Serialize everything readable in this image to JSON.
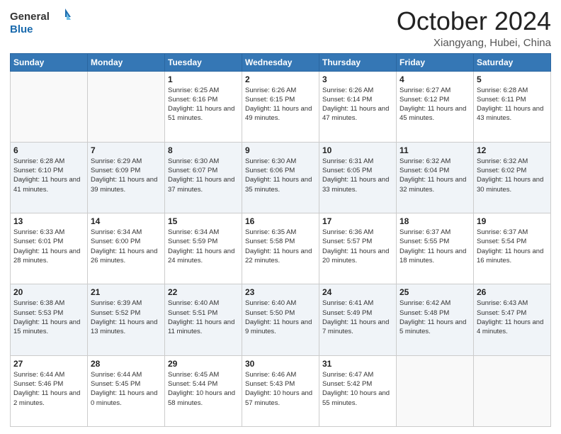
{
  "header": {
    "logo_line1": "General",
    "logo_line2": "Blue",
    "month": "October 2024",
    "location": "Xiangyang, Hubei, China"
  },
  "days_of_week": [
    "Sunday",
    "Monday",
    "Tuesday",
    "Wednesday",
    "Thursday",
    "Friday",
    "Saturday"
  ],
  "weeks": [
    [
      {
        "day": "",
        "sunrise": "",
        "sunset": "",
        "daylight": ""
      },
      {
        "day": "",
        "sunrise": "",
        "sunset": "",
        "daylight": ""
      },
      {
        "day": "1",
        "sunrise": "Sunrise: 6:25 AM",
        "sunset": "Sunset: 6:16 PM",
        "daylight": "Daylight: 11 hours and 51 minutes."
      },
      {
        "day": "2",
        "sunrise": "Sunrise: 6:26 AM",
        "sunset": "Sunset: 6:15 PM",
        "daylight": "Daylight: 11 hours and 49 minutes."
      },
      {
        "day": "3",
        "sunrise": "Sunrise: 6:26 AM",
        "sunset": "Sunset: 6:14 PM",
        "daylight": "Daylight: 11 hours and 47 minutes."
      },
      {
        "day": "4",
        "sunrise": "Sunrise: 6:27 AM",
        "sunset": "Sunset: 6:12 PM",
        "daylight": "Daylight: 11 hours and 45 minutes."
      },
      {
        "day": "5",
        "sunrise": "Sunrise: 6:28 AM",
        "sunset": "Sunset: 6:11 PM",
        "daylight": "Daylight: 11 hours and 43 minutes."
      }
    ],
    [
      {
        "day": "6",
        "sunrise": "Sunrise: 6:28 AM",
        "sunset": "Sunset: 6:10 PM",
        "daylight": "Daylight: 11 hours and 41 minutes."
      },
      {
        "day": "7",
        "sunrise": "Sunrise: 6:29 AM",
        "sunset": "Sunset: 6:09 PM",
        "daylight": "Daylight: 11 hours and 39 minutes."
      },
      {
        "day": "8",
        "sunrise": "Sunrise: 6:30 AM",
        "sunset": "Sunset: 6:07 PM",
        "daylight": "Daylight: 11 hours and 37 minutes."
      },
      {
        "day": "9",
        "sunrise": "Sunrise: 6:30 AM",
        "sunset": "Sunset: 6:06 PM",
        "daylight": "Daylight: 11 hours and 35 minutes."
      },
      {
        "day": "10",
        "sunrise": "Sunrise: 6:31 AM",
        "sunset": "Sunset: 6:05 PM",
        "daylight": "Daylight: 11 hours and 33 minutes."
      },
      {
        "day": "11",
        "sunrise": "Sunrise: 6:32 AM",
        "sunset": "Sunset: 6:04 PM",
        "daylight": "Daylight: 11 hours and 32 minutes."
      },
      {
        "day": "12",
        "sunrise": "Sunrise: 6:32 AM",
        "sunset": "Sunset: 6:02 PM",
        "daylight": "Daylight: 11 hours and 30 minutes."
      }
    ],
    [
      {
        "day": "13",
        "sunrise": "Sunrise: 6:33 AM",
        "sunset": "Sunset: 6:01 PM",
        "daylight": "Daylight: 11 hours and 28 minutes."
      },
      {
        "day": "14",
        "sunrise": "Sunrise: 6:34 AM",
        "sunset": "Sunset: 6:00 PM",
        "daylight": "Daylight: 11 hours and 26 minutes."
      },
      {
        "day": "15",
        "sunrise": "Sunrise: 6:34 AM",
        "sunset": "Sunset: 5:59 PM",
        "daylight": "Daylight: 11 hours and 24 minutes."
      },
      {
        "day": "16",
        "sunrise": "Sunrise: 6:35 AM",
        "sunset": "Sunset: 5:58 PM",
        "daylight": "Daylight: 11 hours and 22 minutes."
      },
      {
        "day": "17",
        "sunrise": "Sunrise: 6:36 AM",
        "sunset": "Sunset: 5:57 PM",
        "daylight": "Daylight: 11 hours and 20 minutes."
      },
      {
        "day": "18",
        "sunrise": "Sunrise: 6:37 AM",
        "sunset": "Sunset: 5:55 PM",
        "daylight": "Daylight: 11 hours and 18 minutes."
      },
      {
        "day": "19",
        "sunrise": "Sunrise: 6:37 AM",
        "sunset": "Sunset: 5:54 PM",
        "daylight": "Daylight: 11 hours and 16 minutes."
      }
    ],
    [
      {
        "day": "20",
        "sunrise": "Sunrise: 6:38 AM",
        "sunset": "Sunset: 5:53 PM",
        "daylight": "Daylight: 11 hours and 15 minutes."
      },
      {
        "day": "21",
        "sunrise": "Sunrise: 6:39 AM",
        "sunset": "Sunset: 5:52 PM",
        "daylight": "Daylight: 11 hours and 13 minutes."
      },
      {
        "day": "22",
        "sunrise": "Sunrise: 6:40 AM",
        "sunset": "Sunset: 5:51 PM",
        "daylight": "Daylight: 11 hours and 11 minutes."
      },
      {
        "day": "23",
        "sunrise": "Sunrise: 6:40 AM",
        "sunset": "Sunset: 5:50 PM",
        "daylight": "Daylight: 11 hours and 9 minutes."
      },
      {
        "day": "24",
        "sunrise": "Sunrise: 6:41 AM",
        "sunset": "Sunset: 5:49 PM",
        "daylight": "Daylight: 11 hours and 7 minutes."
      },
      {
        "day": "25",
        "sunrise": "Sunrise: 6:42 AM",
        "sunset": "Sunset: 5:48 PM",
        "daylight": "Daylight: 11 hours and 5 minutes."
      },
      {
        "day": "26",
        "sunrise": "Sunrise: 6:43 AM",
        "sunset": "Sunset: 5:47 PM",
        "daylight": "Daylight: 11 hours and 4 minutes."
      }
    ],
    [
      {
        "day": "27",
        "sunrise": "Sunrise: 6:44 AM",
        "sunset": "Sunset: 5:46 PM",
        "daylight": "Daylight: 11 hours and 2 minutes."
      },
      {
        "day": "28",
        "sunrise": "Sunrise: 6:44 AM",
        "sunset": "Sunset: 5:45 PM",
        "daylight": "Daylight: 11 hours and 0 minutes."
      },
      {
        "day": "29",
        "sunrise": "Sunrise: 6:45 AM",
        "sunset": "Sunset: 5:44 PM",
        "daylight": "Daylight: 10 hours and 58 minutes."
      },
      {
        "day": "30",
        "sunrise": "Sunrise: 6:46 AM",
        "sunset": "Sunset: 5:43 PM",
        "daylight": "Daylight: 10 hours and 57 minutes."
      },
      {
        "day": "31",
        "sunrise": "Sunrise: 6:47 AM",
        "sunset": "Sunset: 5:42 PM",
        "daylight": "Daylight: 10 hours and 55 minutes."
      },
      {
        "day": "",
        "sunrise": "",
        "sunset": "",
        "daylight": ""
      },
      {
        "day": "",
        "sunrise": "",
        "sunset": "",
        "daylight": ""
      }
    ]
  ]
}
